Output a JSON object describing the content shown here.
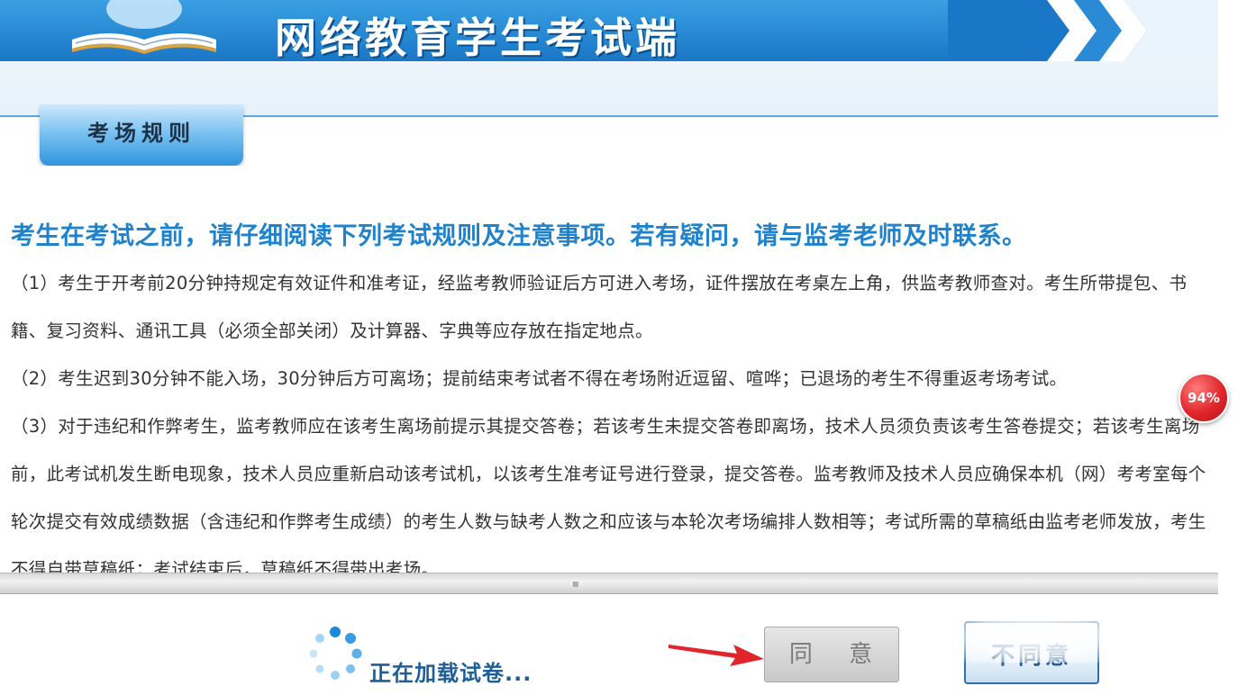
{
  "header": {
    "title": "网络教育学生考试端"
  },
  "section_tab": {
    "label": "考场规则"
  },
  "intro": "考生在考试之前，请仔细阅读下列考试规则及注意事项。若有疑问，请与监考老师及时联系。",
  "rules": [
    "（1）考生于开考前20分钟持规定有效证件和准考证，经监考教师验证后方可进入考场，证件摆放在考桌左上角，供监考教师查对。考生所带提包、书籍、复习资料、通讯工具（必须全部关闭）及计算器、字典等应存放在指定地点。",
    "（2）考生迟到30分钟不能入场，30分钟后方可离场；提前结束考试者不得在考场附近逗留、喧哗；已退场的考生不得重返考场考试。",
    "（3）对于违纪和作弊考生，监考教师应在该考生离场前提示其提交答卷；若该考生未提交答卷即离场，技术人员须负责该考生答卷提交；若该考生离场前，此考试机发生断电现象，技术人员应重新启动该考试机，以该考生准考证号进行登录，提交答卷。监考教师及技术人员应确保本机（网）考考室每个轮次提交有效成绩数据（含违纪和作弊考生成绩）的考生人数与缺考人数之和应该与本轮次考场编排人数相等；考试所需的草稿纸由监考老师发放，考生不得自带草稿纸；考试结束后，草稿纸不得带出考场。"
  ],
  "footer": {
    "loading_text": "正在加载试卷...",
    "agree_label": "同 意",
    "disagree_label": "不同意"
  },
  "badge": {
    "text": "94%"
  },
  "icons": {
    "logo": "open-book-logo-icon",
    "spinner": "loading-spinner-icon",
    "arrow": "red-arrow-icon",
    "chevrons": "double-chevron-icon"
  },
  "colors": {
    "header_blue": "#1a77c7",
    "intro_blue": "#1e82cc",
    "arrow_red": "#e0262b"
  }
}
